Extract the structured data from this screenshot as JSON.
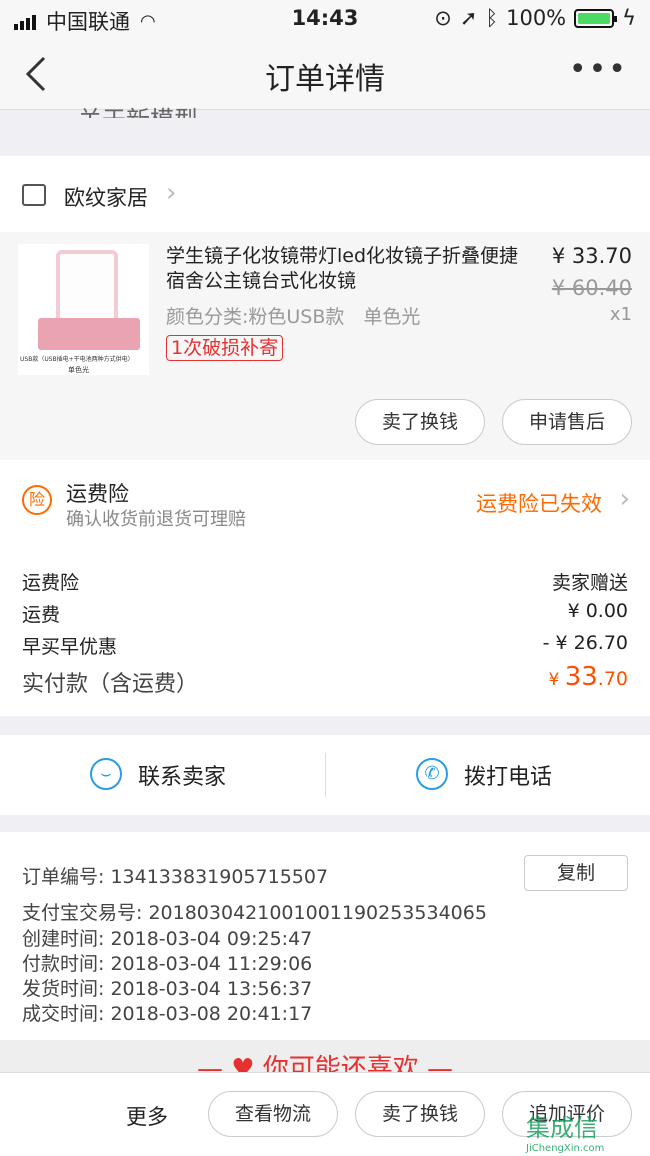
{
  "status_bar": {
    "carrier": "中国联通",
    "time": "14:43",
    "battery": "100%"
  },
  "nav": {
    "title": "订单详情",
    "more": "•••"
  },
  "partial_text": "关于新模型",
  "shop": {
    "name": "欧纹家居"
  },
  "product": {
    "title": "学生镜子化妆镜带灯led化妆镜子折叠便捷宿舍公主镜台式化妆镜",
    "sku": "颜色分类:粉色USB款　单色光",
    "tag": "1次破损补寄",
    "price": "¥ 33.70",
    "original_price": "¥ 60.40",
    "quantity": "x1",
    "image_caption_1": "USB款（USB插电+干电池两种方式供电）",
    "image_caption_2": "单色光",
    "btn_sell": "卖了换钱",
    "btn_aftersale": "申请售后"
  },
  "insurance": {
    "icon_text": "险",
    "title": "运费险",
    "subtitle": "确认收货前退货可理赔",
    "status": "运费险已失效"
  },
  "fees": [
    {
      "label": "运费险",
      "value": "卖家赠送"
    },
    {
      "label": "运费",
      "value": "¥ 0.00"
    },
    {
      "label": "早买早优惠",
      "value": "- ¥ 26.70"
    }
  ],
  "total": {
    "label": "实付款（含运费）",
    "currency": "¥ ",
    "integer": "33",
    "decimal": ".70"
  },
  "contact": {
    "seller": "联系卖家",
    "phone": "拨打电话"
  },
  "order_info": {
    "order_no_label": "订单编号:",
    "order_no": "134133831905715507",
    "copy": "复制",
    "alipay_label": "支付宝交易号:",
    "alipay_no": "2018030421001001190253534065",
    "created_label": "创建时间:",
    "created": "2018-03-04 09:25:47",
    "paid_label": "付款时间:",
    "paid": "2018-03-04 11:29:06",
    "shipped_label": "发货时间:",
    "shipped": "2018-03-04 13:56:37",
    "done_label": "成交时间:",
    "done": "2018-03-08 20:41:17"
  },
  "recommend": {
    "text": "你可能还喜欢"
  },
  "bottom_bar": {
    "more": "更多",
    "logistics": "查看物流",
    "sell": "卖了换钱",
    "review": "追加评价"
  },
  "watermark": {
    "top": "集成信",
    "bottom": "JiChengXin.com"
  },
  "colors": {
    "accent_orange": "#ff5000",
    "tag_red": "#e5312f",
    "contact_blue": "#2a9de8",
    "battery_green": "#4cd964"
  }
}
